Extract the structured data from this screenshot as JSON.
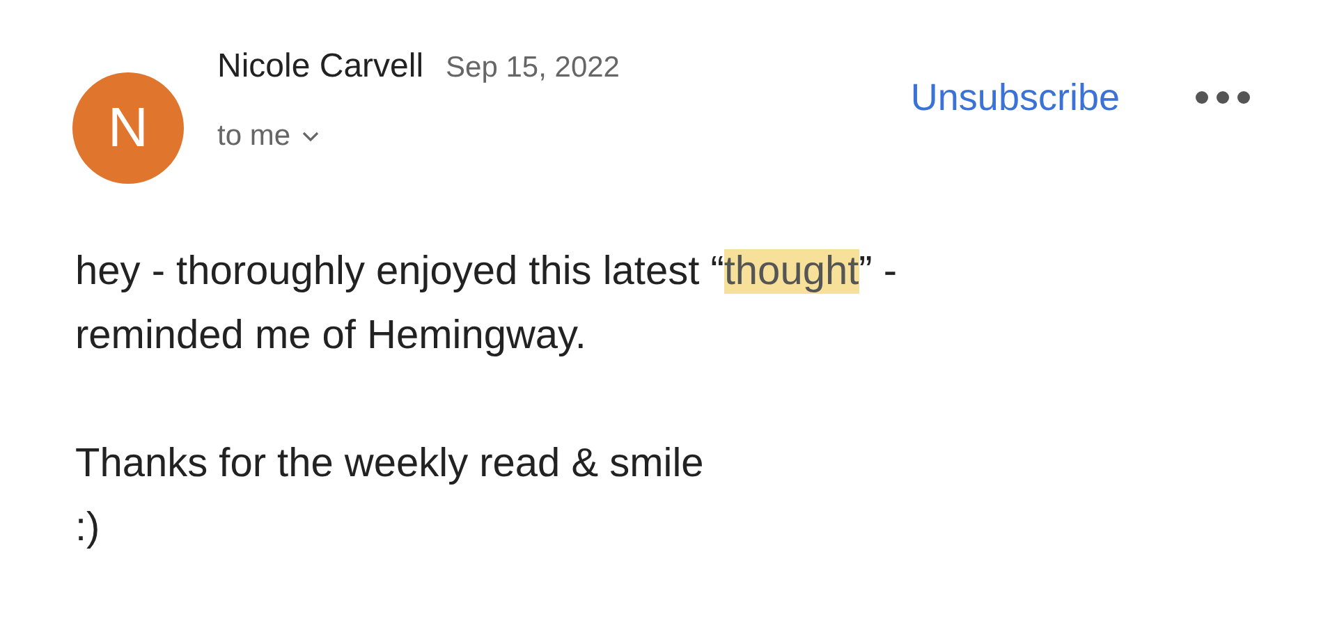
{
  "sender": {
    "initial": "N",
    "name": "Nicole Carvell",
    "date": "Sep 15, 2022",
    "recipient": "to me"
  },
  "actions": {
    "unsubscribe": "Unsubscribe"
  },
  "body": [
    {
      "lines": [
        [
          {
            "text": "hey - thoroughly enjoyed this latest “",
            "highlighted": false
          },
          {
            "text": "thought",
            "highlighted": true
          },
          {
            "text": "” -",
            "highlighted": false
          }
        ],
        [
          {
            "text": "reminded me of Hemingway.",
            "highlighted": false
          }
        ]
      ]
    },
    {
      "lines": [
        [
          {
            "text": "Thanks for the weekly read & smile",
            "highlighted": false
          }
        ],
        [
          {
            "text": ":)",
            "highlighted": false
          }
        ]
      ]
    }
  ]
}
